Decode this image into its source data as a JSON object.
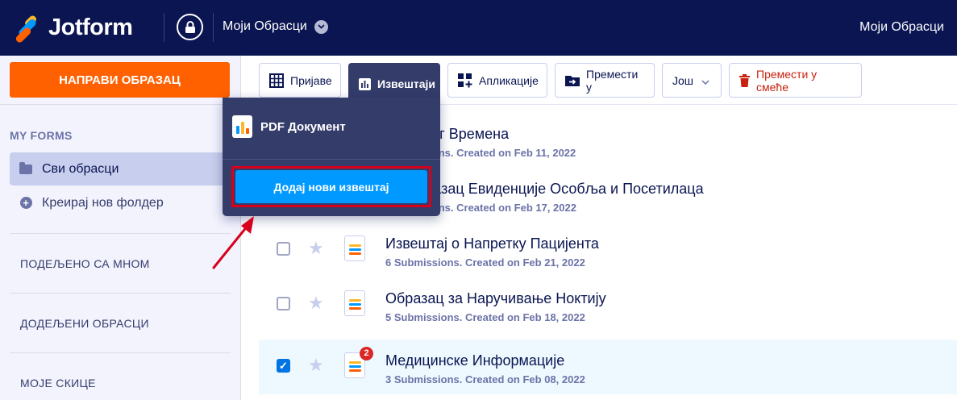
{
  "header": {
    "logo_text": "Jotform",
    "forms_menu_label": "Моји Обрасци",
    "right_label": "Моји Обрасци",
    "eu_icon": "lock-icon"
  },
  "sidebar": {
    "create_button": "НАПРАВИ ОБРАЗАЦ",
    "section_title": "MY FORMS",
    "items": [
      {
        "label": "Сви обрасци",
        "icon": "folder-icon",
        "active": true
      },
      {
        "label": "Креирај нов фолдер",
        "icon": "plus-circle-icon",
        "active": false
      }
    ],
    "sections": [
      "ПОДЕЉЕНО СА МНОМ",
      "ДОДЕЉЕНИ ОБРАСЦИ",
      "МОЈЕ СКИЦЕ"
    ]
  },
  "toolbar": {
    "submissions": "Пријаве",
    "reports": "Извештаји",
    "apps": "Апликације",
    "move_to": "Премести у",
    "more": "Још",
    "trash": "Премести у смеће"
  },
  "dropdown": {
    "pdf_label": "PDF Документ",
    "add_report": "Додај нови извештај"
  },
  "forms": [
    {
      "title": "ц Радног Времена",
      "sub": "Submissions. Created on Feb 11, 2022",
      "checked": false,
      "badge": ""
    },
    {
      "title": "19 Образац Евиденције Особља и Посетилаца",
      "sub": "Submissions. Created on Feb 17, 2022",
      "checked": false,
      "badge": ""
    },
    {
      "title": "Извештај о Напретку Пацијента",
      "sub": "6 Submissions. Created on Feb 21, 2022",
      "checked": false,
      "badge": ""
    },
    {
      "title": "Образац за Наручивање Ноктију",
      "sub": "5 Submissions. Created on Feb 18, 2022",
      "checked": false,
      "badge": ""
    },
    {
      "title": "Медицинске Информације",
      "sub": "3 Submissions. Created on Feb 08, 2022",
      "checked": true,
      "badge": "2"
    }
  ],
  "colors": {
    "navy": "#0a1551",
    "orange": "#ff6100",
    "blue": "#0099ff",
    "highlight_red": "#d7011d"
  }
}
